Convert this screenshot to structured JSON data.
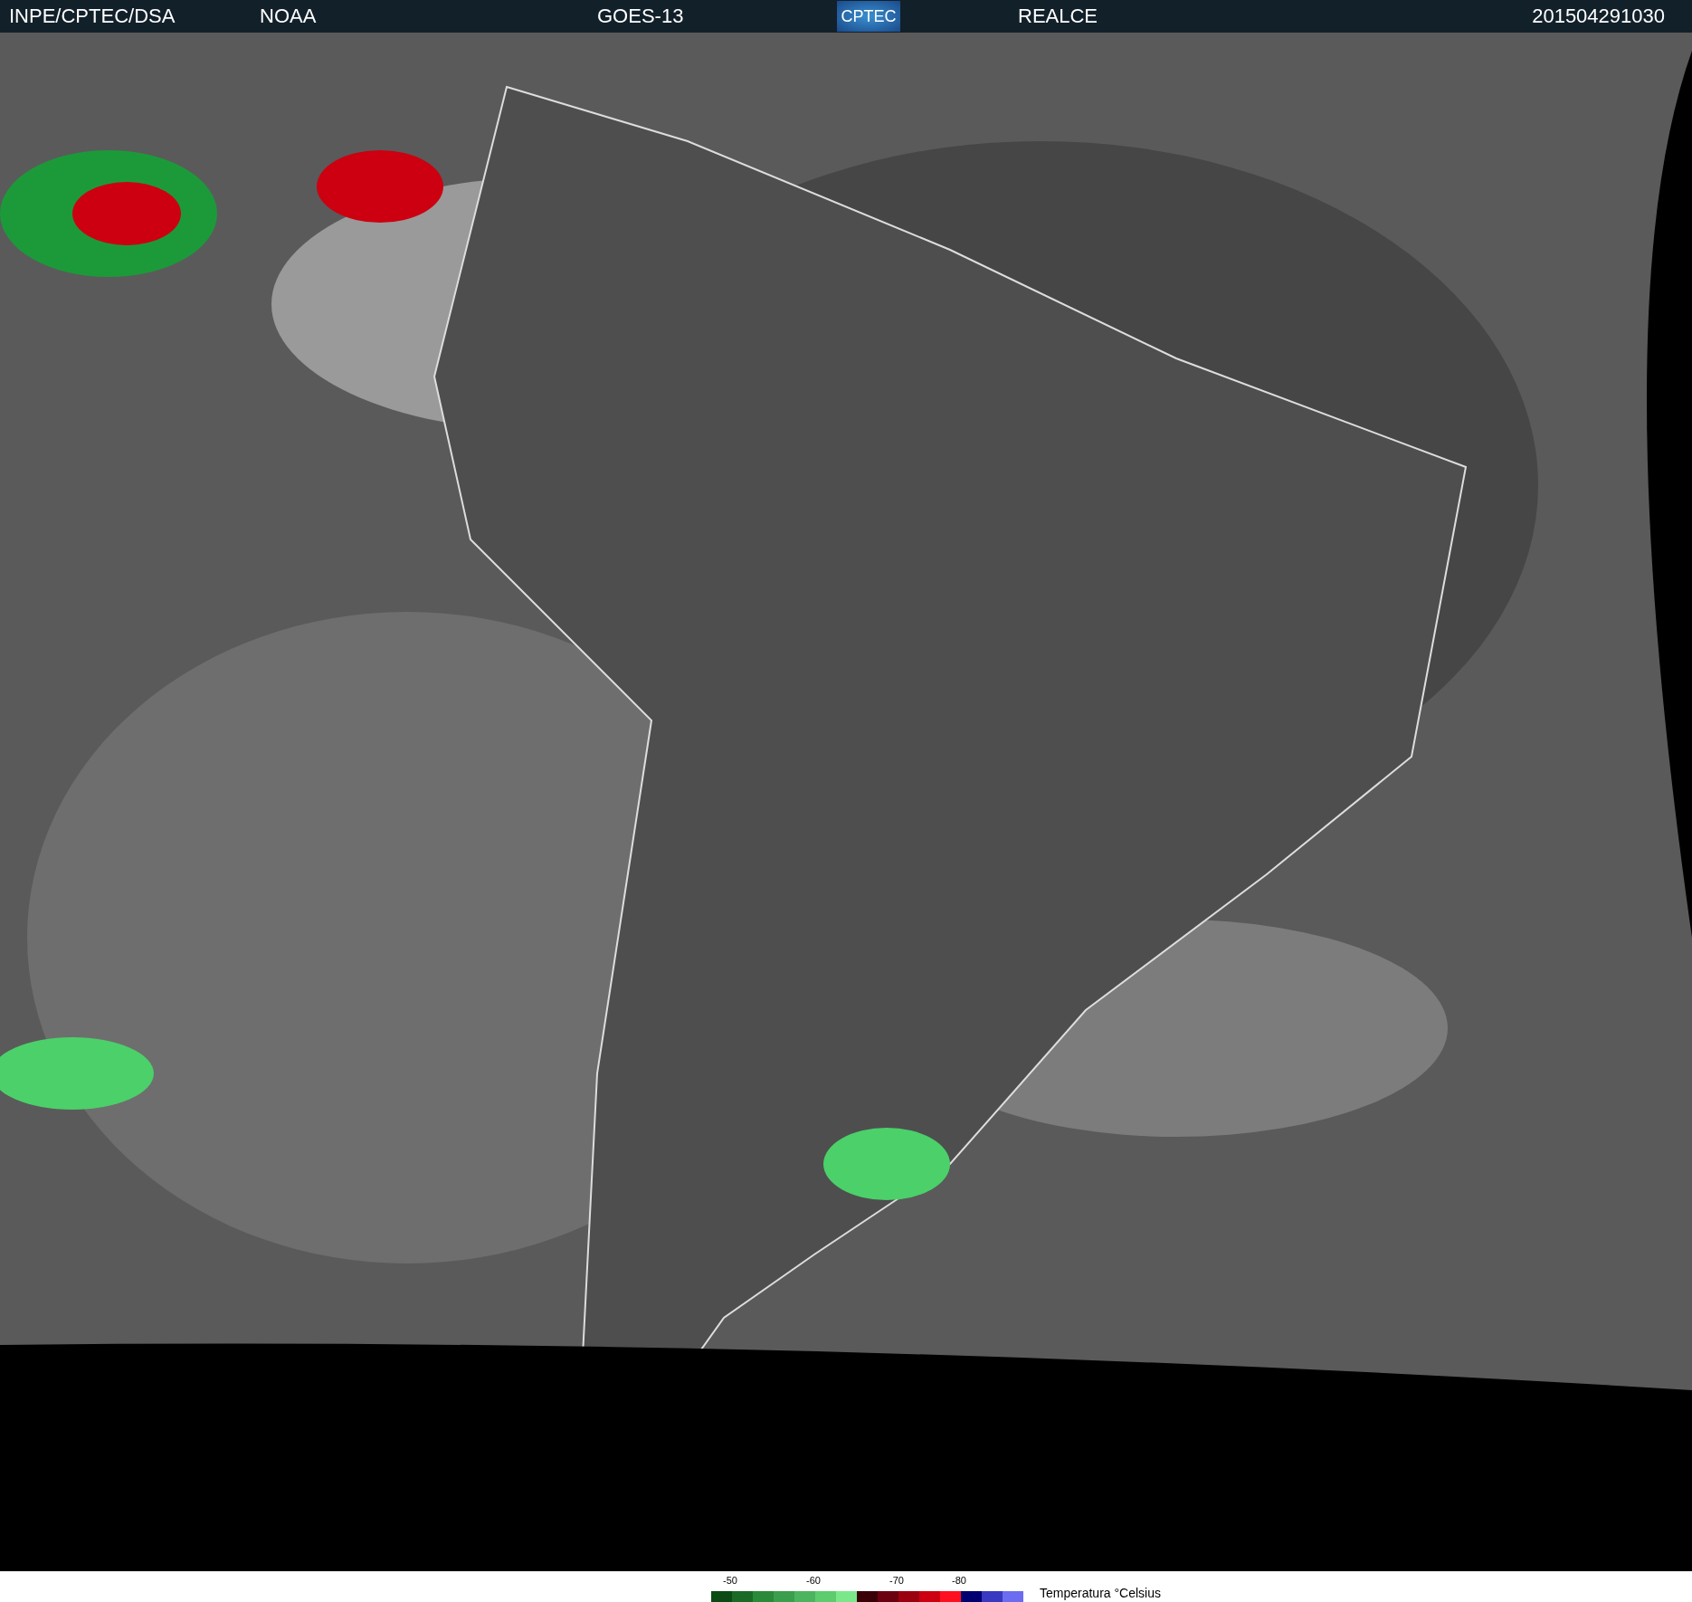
{
  "header": {
    "source": "INPE/CPTEC/DSA",
    "agency": "NOAA",
    "satellite": "GOES-13",
    "logo": "CPTEC",
    "product": "REALCE",
    "timestamp": "201504291030"
  },
  "legend": {
    "title": "Temperatura °Celsius",
    "swatches": [
      {
        "color": "#0b4a14"
      },
      {
        "color": "#1a6a26",
        "label": "-50"
      },
      {
        "color": "#2a8a3a"
      },
      {
        "color": "#3a9e4c"
      },
      {
        "color": "#4cb45e"
      },
      {
        "color": "#5ccc6e",
        "label": "-60"
      },
      {
        "color": "#7ae88a"
      },
      {
        "color": "#3a0008"
      },
      {
        "color": "#6a0010"
      },
      {
        "color": "#9a0010",
        "label": "-70"
      },
      {
        "color": "#cc0010"
      },
      {
        "color": "#ff1020"
      },
      {
        "color": "#000070",
        "label": "-80"
      },
      {
        "color": "#3838c0"
      },
      {
        "color": "#6c6cf0"
      }
    ]
  }
}
